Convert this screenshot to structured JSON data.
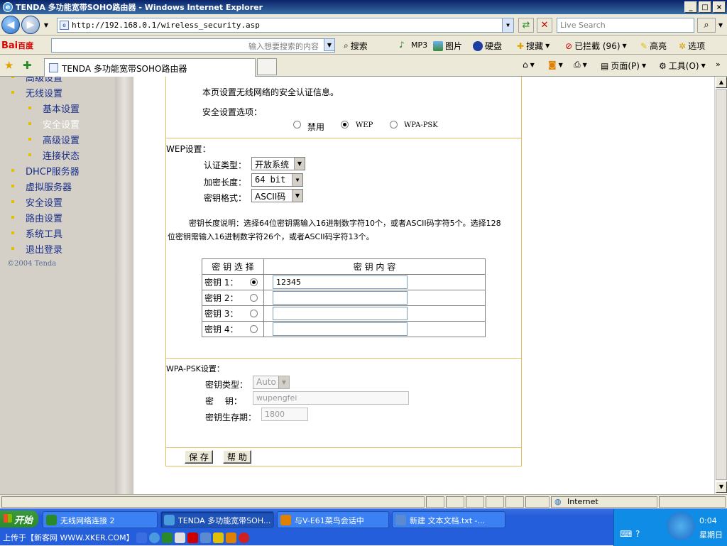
{
  "window": {
    "title": "TENDA 多功能宽带SOHO路由器 - Windows Internet Explorer",
    "controls": [
      "_",
      "□",
      "×"
    ]
  },
  "browser": {
    "url": "http://192.168.0.1/wireless_security.asp",
    "search_placeholder": "Live Search",
    "tab_title": "TENDA 多功能宽带SOHO路由器"
  },
  "baidu_toolbar": {
    "logo_red": "Bai",
    "logo_blue": "百度",
    "input_placeholder": "输入想要搜索的内容",
    "items": [
      "搜索",
      "MP3",
      "图片",
      "硬盘",
      "搜藏",
      "已拦截 (96)",
      "高亮",
      "选项"
    ]
  },
  "command_bar": {
    "page": "页面(P)",
    "tools": "工具(O)"
  },
  "sidebar": {
    "items": [
      {
        "label": "高级设置",
        "level": 0
      },
      {
        "label": "无线设置",
        "level": 0
      },
      {
        "label": "基本设置",
        "level": 1
      },
      {
        "label": "安全设置",
        "level": 1
      },
      {
        "label": "高级设置",
        "level": 1
      },
      {
        "label": "连接状态",
        "level": 1
      },
      {
        "label": "DHCP服务器",
        "level": 0
      },
      {
        "label": "虚拟服务器",
        "level": 0
      },
      {
        "label": "安全设置",
        "level": 0
      },
      {
        "label": "路由设置",
        "level": 0
      },
      {
        "label": "系统工具",
        "level": 0
      },
      {
        "label": "退出登录",
        "level": 0
      }
    ],
    "copyright": "©2004 Tenda"
  },
  "page": {
    "intro": "本页设置无线网络的安全认证信息。",
    "security_option_label": "安全设置选项：",
    "security_options": [
      "禁用",
      "WEP",
      "WPA-PSK"
    ],
    "security_selected": "WEP",
    "wep_title": "WEP设置：",
    "auth_type_label": "认证类型：",
    "auth_type_value": "开放系统",
    "key_length_label": "加密长度：",
    "key_length_value": "64 bit",
    "key_format_label": "密钥格式：",
    "key_format_value": "ASCII码",
    "key_note_line1": "密钥长度说明：选择64位密钥需输入16进制数字符10个，或者ASCII码字符5个。选择128",
    "key_note_line2": "位密钥需输入16进制数字符26个，或者ASCII码字符13个。",
    "key_table_headers": [
      "密 钥 选 择",
      "密 钥 内 容"
    ],
    "keys": [
      {
        "label": "密钥 1：",
        "value": "12345",
        "selected": true
      },
      {
        "label": "密钥 2：",
        "value": "",
        "selected": false
      },
      {
        "label": "密钥 3：",
        "value": "",
        "selected": false
      },
      {
        "label": "密钥 4：",
        "value": "",
        "selected": false
      }
    ],
    "wpa_title": "WPA-PSK设置：",
    "wpa_key_type_label": "密钥类型：",
    "wpa_key_type_value": "Auto",
    "wpa_key_label": "密　 钥：",
    "wpa_key_value": "wupengfei",
    "wpa_lifetime_label": "密钥生存期：",
    "wpa_lifetime_value": "1800",
    "save_label": "保 存",
    "help_label": "帮 助"
  },
  "status": {
    "zone": "Internet"
  },
  "taskbar": {
    "start": "开始",
    "tasks": [
      "无线网络连接 2",
      "TENDA 多功能宽带SOH...",
      "与V-E61菜鸟会话中",
      "新建 文本文档.txt -..."
    ],
    "quick_text": "上传于【新客网 WWW.XKER.COM】",
    "clock": "0:04",
    "weekday": "星期日"
  }
}
